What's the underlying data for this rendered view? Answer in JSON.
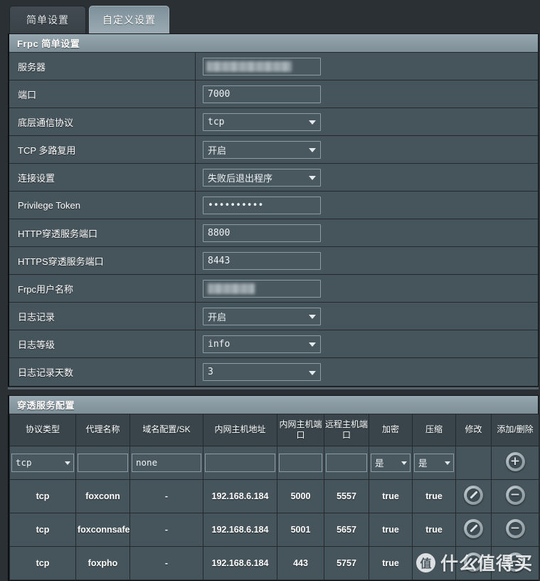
{
  "tabs": [
    {
      "label": "简单设置",
      "state": "inactive"
    },
    {
      "label": "自定义设置",
      "state": "active"
    }
  ],
  "basic_panel": {
    "title": "Frpc 简单设置",
    "rows": [
      {
        "label": "服务器",
        "kind": "text-redacted",
        "value": "",
        "redact": "long"
      },
      {
        "label": "端口",
        "kind": "text",
        "value": "7000"
      },
      {
        "label": "底层通信协议",
        "kind": "select",
        "value": "tcp",
        "mono": true
      },
      {
        "label": "TCP 多路复用",
        "kind": "select",
        "value": "开启",
        "mono": false
      },
      {
        "label": "连接设置",
        "kind": "select",
        "value": "失败后退出程序",
        "mono": false
      },
      {
        "label": "Privilege Token",
        "kind": "password",
        "value": "••••••••••"
      },
      {
        "label": "HTTP穿透服务端口",
        "kind": "text",
        "value": "8800"
      },
      {
        "label": "HTTPS穿透服务端口",
        "kind": "text",
        "value": "8443"
      },
      {
        "label": "Frpc用户名称",
        "kind": "text-redacted",
        "value": "",
        "redact": "short"
      },
      {
        "label": "日志记录",
        "kind": "select",
        "value": "开启",
        "mono": false
      },
      {
        "label": "日志等级",
        "kind": "select",
        "value": "info",
        "mono": true
      },
      {
        "label": "日志记录天数",
        "kind": "select",
        "value": "3",
        "mono": true
      }
    ]
  },
  "service_panel": {
    "title": "穿透服务配置",
    "columns": [
      "协议类型",
      "代理名称",
      "域名配置/SK",
      "内网主机地址",
      "内网主机端口",
      "远程主机端口",
      "加密",
      "压缩",
      "修改",
      "添加/删除"
    ],
    "new_row": {
      "protocol": "tcp",
      "proxy_name": "",
      "domain_sk": "none",
      "local_ip": "",
      "local_port": "",
      "remote_port": "",
      "encrypt": "是",
      "compress": "是",
      "add_icon": "plus-circle-icon"
    },
    "rows": [
      {
        "protocol": "tcp",
        "proxy_name": "foxconn",
        "domain_sk": "-",
        "local_ip": "192.168.6.184",
        "local_port": "5000",
        "remote_port": "5557",
        "encrypt": "true",
        "compress": "true",
        "edit_icon": "pencil-circle-icon",
        "delete_icon": "minus-circle-icon"
      },
      {
        "protocol": "tcp",
        "proxy_name": "foxconnsafe",
        "domain_sk": "-",
        "local_ip": "192.168.6.184",
        "local_port": "5001",
        "remote_port": "5657",
        "encrypt": "true",
        "compress": "true",
        "edit_icon": "pencil-circle-icon",
        "delete_icon": "minus-circle-icon"
      },
      {
        "protocol": "tcp",
        "proxy_name": "foxpho",
        "domain_sk": "-",
        "local_ip": "192.168.6.184",
        "local_port": "443",
        "remote_port": "5757",
        "encrypt": "true",
        "compress": "",
        "edit_icon": "pencil-circle-icon",
        "delete_icon": "minus-circle-icon"
      }
    ]
  },
  "watermark": {
    "logo_glyph": "值",
    "text": "什么值得买"
  },
  "colors": {
    "page_bg": "#2a3034",
    "panel_bg": "#46545b",
    "panel_header": "#8c9ca4",
    "field_bg": "#49575e",
    "field_border": "#8d9ba2",
    "grid_line": "#222a2e",
    "text": "#ffffff"
  }
}
